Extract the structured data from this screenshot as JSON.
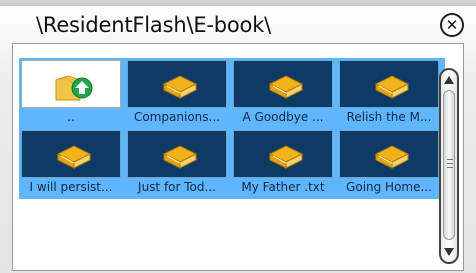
{
  "window": {
    "title": "\\ResidentFlash\\E-book\\"
  },
  "items": [
    {
      "label": "..",
      "icon": "folder-up-icon"
    },
    {
      "label": "Companions...",
      "icon": "book-icon"
    },
    {
      "label": "A Goodbye ...",
      "icon": "book-icon"
    },
    {
      "label": "Relish the M...",
      "icon": "book-icon"
    },
    {
      "label": "I will persist...",
      "icon": "book-icon"
    },
    {
      "label": "Just for Tod...",
      "icon": "book-icon"
    },
    {
      "label": "My Father .txt",
      "icon": "book-icon"
    },
    {
      "label": "Going Home...",
      "icon": "book-icon"
    }
  ],
  "colors": {
    "selection": "#5fb6ff",
    "tile": "#0e3a63",
    "book": "#f0b21b",
    "up_arrow": "#22a64b"
  }
}
